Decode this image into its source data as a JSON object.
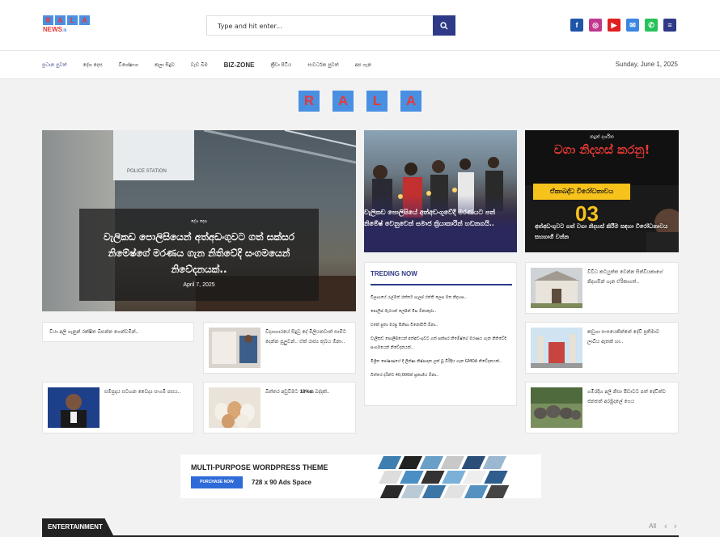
{
  "header": {
    "logo_letters": [
      "R",
      "A",
      "L",
      "A"
    ],
    "logo_news": "NEWS",
    "logo_tld": ".lk",
    "search_placeholder": "Type and hit enter...",
    "social": [
      {
        "name": "facebook-icon",
        "glyph": "f",
        "color": "#1f55a8"
      },
      {
        "name": "instagram-icon",
        "glyph": "◎",
        "color": "#c2388f"
      },
      {
        "name": "youtube-icon",
        "glyph": "▶",
        "color": "#e02020"
      },
      {
        "name": "email-icon",
        "glyph": "✉",
        "color": "#3b86e0"
      },
      {
        "name": "whatsapp-icon",
        "glyph": "✆",
        "color": "#27c25a"
      },
      {
        "name": "menu-icon",
        "glyph": "≡",
        "color": "#2e3a87"
      }
    ]
  },
  "nav": {
    "items": [
      "ප්‍රධාන පුවත්",
      "දේශ දෙස",
      "විශේෂාංග",
      "කලා සිදුව",
      "වැඩ බිම",
      "BIZ-ZONE",
      "ක්‍රීඩා පිටිය",
      "සංවර්ධන පුවත්",
      "අප ගැන"
    ],
    "date": "Sunday, June 1, 2025"
  },
  "biglogo": [
    "R",
    "A",
    "L",
    "A"
  ],
  "hero": {
    "board_text": "POLICE STATION",
    "category": "දේශ දෙස",
    "title": "වැලිකඩ පොලිසියෙන් අත්අඩංගුවට ගත් සක්සර නිමේෂ්ගේ මරණය ගැන නිතිවේදි සංගමයෙන් නිවේදනයක්..",
    "date": "April 7, 2025"
  },
  "card2": {
    "title": "වැලිකඩ පොලිසියේ අත්අඩංගුවේදී මරණයට පත් නිමේෂ් වෙනුවෙන් සමාජ ක්‍රියාකාරින් හඩනගයි.."
  },
  "card3": {
    "line1": "නදුන් දර්ශිත",
    "line2": "වගා නිදහස් කරනු!",
    "banner": "ඒකාබද්ධ විරෝධතාවය",
    "num": "03",
    "title": "අත්අඩංගුවට ගත් වගා නිදහස් කිරීම සඳහා විරෝධතාවය සහභාගී වන්න"
  },
  "leftcol": {
    "text_card": "වියා අලි ගැනුන් රක්ෂිත බිසන්න ගෙන්වමින්..",
    "mini1": "විද්‍යාගාරයේ සිදුවූ දේ මිලියනවාත් සාමීට දෙන්න පුලුවන්.. ඒක් රාජ්‍ය තුබය ඕනා..",
    "mini2": "සම්ප්‍රදාය සටහන වෛද්‍ය සංගමි පසය..",
    "mini3_a": "බිත්තර අඩුවීමට ",
    "mini3_b": "18%ක",
    "mini3_c": " බද්දක්.."
  },
  "trending": {
    "heading": "TREDING NOW",
    "items": [
      "විලාශයේ රැල්මත් රත්තර් ගැලප් රත්ති ලෙස මත නිදහස..",
      "පොලිස් මැරයන් ලෙසින් මිස ඕනාකුරා..",
      "එකේ පුතා මරපු මිනිසා විනෝවියි ඕනා..",
      "වැලිකඩ පොලිසියෙන් අත්අඩංගුවට ගත් සක්සර නිමේෂ්ගේ මරණය ගැන නිතිවේදි සංගමයෙන් නිවේදනයක්..",
      "මිශ්‍රිත පෝෂණයේ දී ලින්ෂා නිෂ්පාදන ලක් බූ බිරිදිය ගැන GMOA නිවේදනයක්..",
      "බීත්තර දරින්ට 40,000ක් ප්‍රකාශිය ඕනා.."
    ]
  },
  "rightcol": {
    "mini1": "විවිධ කටයුත්ත වෙන්න සිත්වියකාගේ නිදහසින් ගැන ඒරිකාගත්..",
    "mini2": "කඩුගා සංඝයෙකින්නේ දේවි ප්‍රතිමාව ලාබිය ඇතක් හා..",
    "mini3": "ගමිරදිහ අලි නිසා පීඩාවට පත් දේවිත්ව ජනතන් අරමුදලේ ගෙය"
  },
  "ad": {
    "headline": "MULTI-PURPOSE WORDPRESS THEME",
    "button": "PURCHASE NOW",
    "size": "728 x 90 Ads Space"
  },
  "entertainment": {
    "tab": "ENTERTAINMENT",
    "all": "All"
  }
}
